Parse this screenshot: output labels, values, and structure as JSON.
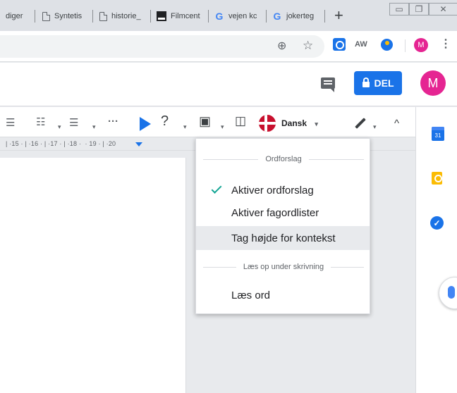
{
  "browser": {
    "tabs": [
      {
        "title": "diger",
        "favicon": "none"
      },
      {
        "title": "Syntetis",
        "favicon": "doc-icon"
      },
      {
        "title": "historie_",
        "favicon": "doc-icon"
      },
      {
        "title": "Filmcent",
        "favicon": "film-icon"
      },
      {
        "title": "vejen kc",
        "favicon": "google-icon"
      },
      {
        "title": "jokerteg",
        "favicon": "google-icon"
      }
    ],
    "google_letter": "G",
    "new_tab": "+",
    "window_controls": {
      "minimize": "▭",
      "restore": "❐",
      "close": "✕"
    },
    "toolbar": {
      "ext_aw": "AW",
      "avatar": "M",
      "menu": "⋮",
      "zoom": "⊕",
      "star": "☆"
    }
  },
  "docs": {
    "share_label": "DEL",
    "avatar": "M",
    "toolbar": {
      "more": "···",
      "language": "Dansk",
      "caret": "▾",
      "collapse": "^"
    },
    "ruler": "| ·15 · | ·16 · | ·17 · | ·18 ·  · 19 · | ·20",
    "side_calendar": "31"
  },
  "menu": {
    "section1": "Ordforslag",
    "items1": [
      {
        "label": "Aktiver ordforslag",
        "checked": true
      },
      {
        "label": "Aktiver fagordlister",
        "checked": false
      },
      {
        "label": "Tag højde for kontekst",
        "checked": false,
        "hovered": true
      }
    ],
    "section2": "Læs op under skrivning",
    "items2": [
      {
        "label": "Læs ord",
        "checked": false
      }
    ]
  },
  "colors": {
    "accent": "#1a73e8",
    "avatar": "#e52592",
    "check": "#12a594"
  }
}
